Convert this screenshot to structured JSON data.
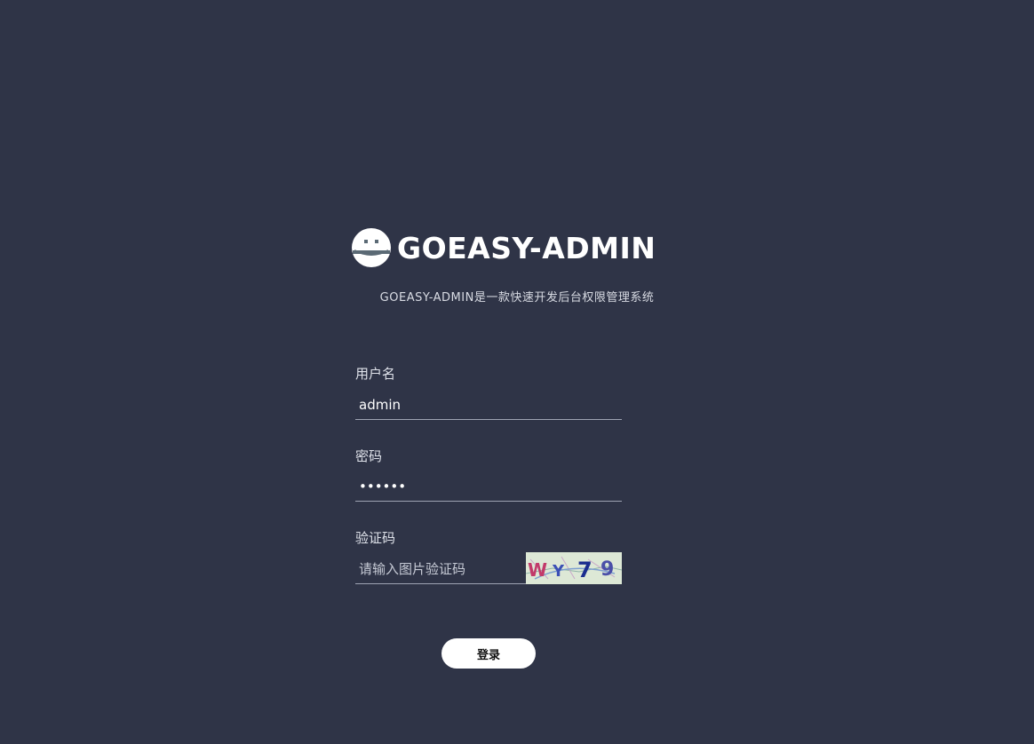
{
  "brand": {
    "title": "GOEASY-ADMIN",
    "subtitle": "GOEASY-ADMIN是一款快速开发后台权限管理系统"
  },
  "form": {
    "username": {
      "label": "用户名",
      "value": "admin"
    },
    "password": {
      "label": "密码",
      "value": "••••••"
    },
    "captcha": {
      "label": "验证码",
      "placeholder": "请输入图片验证码",
      "image_text": "WY79"
    },
    "submit_label": "登录"
  },
  "colors": {
    "background": "#2f3447",
    "button": "#ffffff",
    "underline": "#9ea3b3"
  }
}
